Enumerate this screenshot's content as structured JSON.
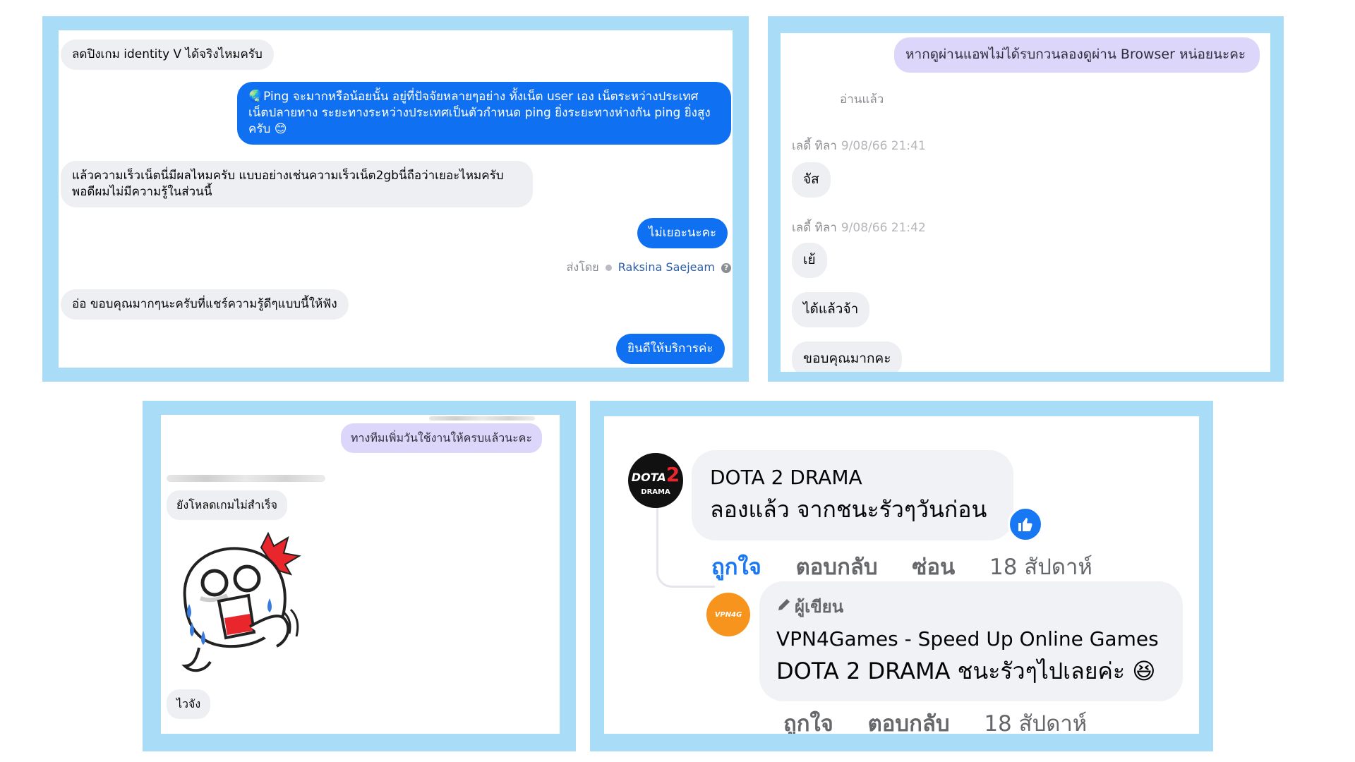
{
  "panel1": {
    "messages": [
      {
        "dir": "in",
        "text": "ลดปิงเกม identity V ได้จริงไหมครับ"
      },
      {
        "dir": "out",
        "text": "🌏Ping จะมากหรือน้อยนั้น อยู่ที่ปัจจัยหลายๆอย่าง ทั้งเน็ต user เอง เน็ตระหว่างประเทศ เน็ตปลายทาง ระยะทางระหว่างประเทศเป็นตัวกำหนด ping  ยิ่งระยะทางห่างกัน ping ยิ่งสูงครับ 😊"
      },
      {
        "dir": "in",
        "text": "แล้วความเร็วเน็ตนี่มีผลไหมครับ แบบอย่างเช่นความเร็วเน็ต2gbนี่ถือว่าเยอะไหมครับ พอดีผมไม่มีความรู้ในส่วนนี้"
      },
      {
        "dir": "out",
        "text": "ไม่เยอะนะคะ"
      },
      {
        "dir": "in",
        "text": "อ่อ ขอบคุณมากๆนะครับที่แชร์ความรู้ดีๆแบบนี้ให้ฟัง"
      },
      {
        "dir": "out",
        "text": "ยินดีให้บริการค่ะ"
      }
    ],
    "sent_by_label": "ส่งโดย",
    "sent_by_name": "Raksina Saejeam",
    "help_glyph": "?"
  },
  "panel2": {
    "out_message": "หากดูผ่านแอพไม่ได้รบกวนลองดูผ่าน Browser หน่อยนะคะ",
    "read_label": "อ่านแล้ว",
    "sender": "เลดี้ ทิลา",
    "time1": "9/08/66 21:41",
    "time2": "9/08/66 21:42",
    "replies": [
      "จัส",
      "เย้",
      "ได้แล้วจ้า",
      "ขอบคุณมากคะ"
    ]
  },
  "panel3": {
    "out_message": "ทางทีมเพิ่มวันใช้งานให้ครบแล้วนะคะ",
    "msg1": "ยังโหลดเกมไม่สำเร็จ",
    "msg2": "ไวจัง",
    "sticker": "crying-character-sticker"
  },
  "panel4": {
    "comment": {
      "author": "DOTA 2 DRAMA",
      "text": "ลองแล้ว จากชนะรัวๆวันก่อน",
      "logo_text": "DOTA",
      "logo_sub": "DRAMA",
      "logo_num": "2",
      "actions": {
        "like": "ถูกใจ",
        "reply": "ตอบกลับ",
        "hide": "ซ่อน",
        "time": "18 สัปดาห์"
      }
    },
    "reply": {
      "badge": "ผู้เขียน",
      "author": "VPN4Games - Speed Up Online Games",
      "text": "DOTA 2 DRAMA ชนะรัวๆไปเลยค่ะ 😆",
      "avatar_text": "VPN4G",
      "actions": {
        "like": "ถูกใจ",
        "reply": "ตอบกลับ",
        "time": "18 สัปดาห์"
      }
    },
    "colors": {
      "like": "#1877f2",
      "bubble": "#f0f2f5",
      "brand_orange": "#f7941d"
    }
  },
  "colors": {
    "frame": "#a9dcf7",
    "messenger_blue": "#1070f2",
    "bubble_gray": "#eeeff2",
    "lavender": "#dcd6fa"
  }
}
